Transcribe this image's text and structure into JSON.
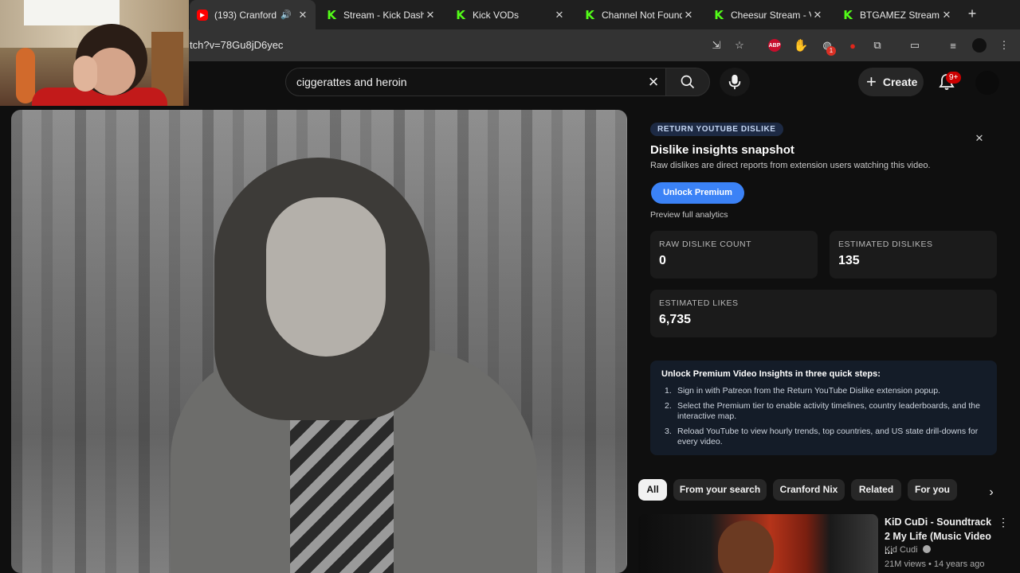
{
  "browser": {
    "tabs": [
      {
        "title": "(193) Cranford",
        "favicon": "youtube-icon",
        "active": true,
        "audio": true
      },
      {
        "title": "Stream - Kick Dash",
        "favicon": "kick-icon"
      },
      {
        "title": "Kick VODs",
        "favicon": "kick-icon"
      },
      {
        "title": "Channel Not Found",
        "favicon": "kick-icon"
      },
      {
        "title": "Cheesur Stream - V",
        "favicon": "kick-icon"
      },
      {
        "title": "BTGAMEZ Stream",
        "favicon": "kick-icon"
      }
    ],
    "new_tab": "+",
    "url": "tch?v=78Gu8jD6yec",
    "ext_badge": "1",
    "abp_label": "ABP"
  },
  "masthead": {
    "search_value": "ciggerattes and heroin",
    "create_label": "Create",
    "notif_badge": "9+"
  },
  "ryd": {
    "pill": "RETURN YOUTUBE DISLIKE",
    "title": "Dislike insights snapshot",
    "subtitle": "Raw dislikes are direct reports from extension users watching this video.",
    "unlock_label": "Unlock Premium",
    "preview_label": "Preview full analytics",
    "stats": {
      "raw_label": "RAW DISLIKE COUNT",
      "raw_value": "0",
      "est_dislikes_label": "ESTIMATED DISLIKES",
      "est_dislikes_value": "135",
      "est_likes_label": "ESTIMATED LIKES",
      "est_likes_value": "6,735"
    },
    "steps_heading": "Unlock Premium Video Insights in three quick steps:",
    "steps": [
      {
        "n": "1.",
        "text": "Sign in with Patreon from the Return YouTube Dislike extension popup."
      },
      {
        "n": "2.",
        "text": "Select the Premium tier to enable activity timelines, country leaderboards, and the interactive map."
      },
      {
        "n": "3.",
        "text": "Reload YouTube to view hourly trends, top countries, and US state drill-downs for every video."
      }
    ]
  },
  "chips": [
    "All",
    "From your search",
    "Cranford Nix",
    "Related",
    "For you"
  ],
  "recommendation": {
    "title": "KiD CuDi - Soundtrack 2 My Life (Music Video ...",
    "channel": "Kid Cudi",
    "meta": "21M views • 14 years ago"
  },
  "colors": {
    "accent": "#3b82f6",
    "kick": "#53fc18",
    "youtube": "#ff0000"
  }
}
